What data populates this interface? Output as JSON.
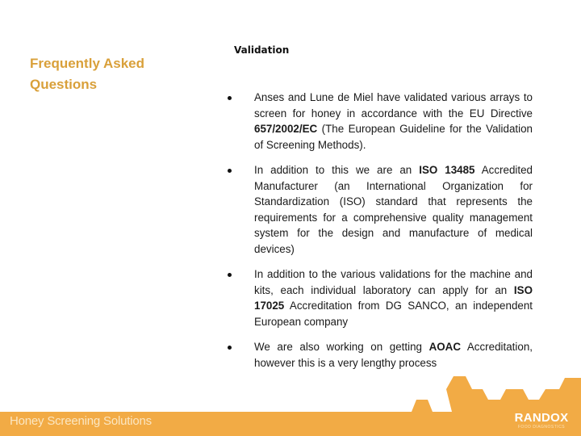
{
  "sidebar": {
    "title": "Frequently Asked Questions"
  },
  "main": {
    "heading": "Validation",
    "bullets": [
      {
        "before": "Anses and Lune de Miel have validated various arrays to screen for honey in accordance with the EU Directive ",
        "bold": "657/2002/EC",
        "after": " (The European Guideline for the Validation of Screening Methods)."
      },
      {
        "before": "In addition to this we are an ",
        "bold": "ISO 13485",
        "after": " Accredited Manufacturer (an International Organization for Standardization (ISO) standard that represents the requirements for a comprehensive quality management system for the design and manufacture of medical devices)"
      },
      {
        "before": "In addition to the various validations for the machine and kits, each individual laboratory can apply for an ",
        "bold": "ISO 17025",
        "after": " Accreditation from DG SANCO, an independent European company"
      },
      {
        "before": "We are also working on getting ",
        "bold": "AOAC",
        "after": " Accreditation, however this is a very lengthy process"
      }
    ]
  },
  "footer": {
    "tagline": "Honey Screening Solutions",
    "logo_main": "RANDOX",
    "logo_sub": "FOOD DIAGNOSTICS",
    "band_color": "#F2AB45"
  },
  "colors": {
    "accent": "#D9A03A",
    "text": "#1a1a1a"
  }
}
